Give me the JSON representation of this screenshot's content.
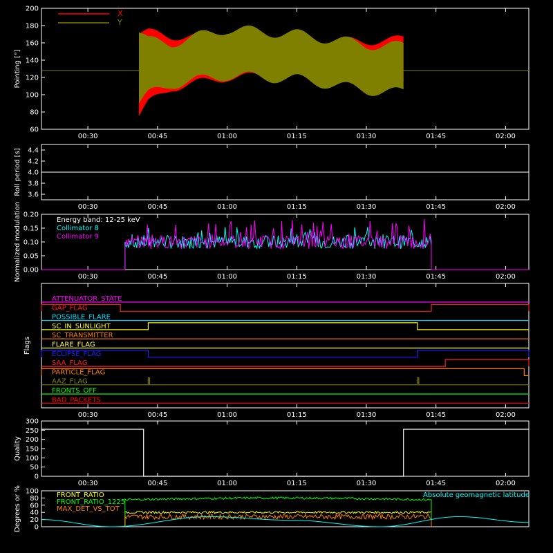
{
  "time_axis": {
    "range": [
      "00:20",
      "02:05"
    ],
    "ticks": [
      "00:30",
      "00:45",
      "01:00",
      "01:15",
      "01:30",
      "01:45",
      "02:00"
    ]
  },
  "chart_data": [
    {
      "id": "pointing",
      "type": "area",
      "ylabel": "Pointing [\"]",
      "ylim": [
        60,
        200
      ],
      "yticks": [
        "60",
        "80",
        "100",
        "120",
        "140",
        "160",
        "180",
        "200"
      ],
      "x_range": [
        "00:41",
        "01:38"
      ],
      "baseline": 128,
      "legend": [
        {
          "name": "X",
          "color": "#ff0000"
        },
        {
          "name": "Y",
          "color": "#808000"
        }
      ],
      "series": [
        {
          "name": "X",
          "color": "#ff0000",
          "envelope": {
            "x": [
              "00:41",
              "00:43",
              "00:48",
              "01:00",
              "01:15",
              "01:30",
              "01:38"
            ],
            "upper": [
              170,
              172,
              168,
              166,
              162,
              162,
              164
            ],
            "lower": [
              75,
              90,
              108,
              120,
              122,
              118,
              112
            ]
          }
        },
        {
          "name": "Y",
          "color": "#808000",
          "envelope": {
            "x": [
              "00:41",
              "00:43",
              "00:48",
              "01:00",
              "01:15",
              "01:30",
              "01:38"
            ],
            "upper": [
              172,
              162,
              160,
              176,
              170,
              158,
              156
            ],
            "lower": [
              90,
              100,
              112,
              122,
              118,
              105,
              102
            ]
          }
        }
      ]
    },
    {
      "id": "roll",
      "type": "line",
      "ylabel": "Roll period [s]",
      "ylim": [
        3.5,
        4.5
      ],
      "yticks": [
        "3.6",
        "3.8",
        "4.0",
        "4.2",
        "4.4"
      ],
      "series": [
        {
          "name": "",
          "color": "#ffffff",
          "x": [
            "00:20",
            "02:05"
          ],
          "y": [
            4.0,
            4.0
          ]
        }
      ]
    },
    {
      "id": "modulation",
      "type": "line",
      "ylabel": "Normalized modulation",
      "ylim": [
        0,
        0.2
      ],
      "yticks": [
        "0.00",
        "0.05",
        "0.10",
        "0.15",
        "0.20"
      ],
      "annotation": "Energy band: 12-25 keV",
      "active_range": [
        "00:38",
        "01:44"
      ],
      "series": [
        {
          "name": "Collimator 8",
          "color": "#00ffff",
          "mean": 0.1,
          "min": 0.075,
          "max": 0.155
        },
        {
          "name": "Collimator 9",
          "color": "#ff00ff",
          "mean": 0.1,
          "min": 0.07,
          "max": 0.185
        }
      ]
    },
    {
      "id": "flags",
      "type": "line",
      "ylabel": "Flags",
      "flags": [
        {
          "name": "ATTENUATOR_STATE",
          "color": "#ff00ff",
          "changes": []
        },
        {
          "name": "GAP_FLAG",
          "color": "#ff2020",
          "changes": [
            {
              "from": "00:20",
              "to": "00:37",
              "state": 1
            },
            {
              "from": "01:44",
              "to": "02:05",
              "state": 1
            }
          ]
        },
        {
          "name": "POSSIBLE_FLARE",
          "color": "#00e0ff",
          "changes": []
        },
        {
          "name": "SC_IN_SUNLIGHT",
          "color": "#ffff00",
          "changes": [
            {
              "from": "00:43",
              "to": "01:41",
              "state": 1
            }
          ]
        },
        {
          "name": "SC_TRANSMITTER",
          "color": "#ff8000",
          "changes": []
        },
        {
          "name": "FLARE_FLAG",
          "color": "#ffff60",
          "changes": []
        },
        {
          "name": "ECLIPSE_FLAG",
          "color": "#2020ff",
          "changes": [
            {
              "from": "00:20",
              "to": "00:43",
              "state": 1
            },
            {
              "from": "01:41",
              "to": "02:05",
              "state": 1
            }
          ]
        },
        {
          "name": "SAA_FLAG",
          "color": "#ff2020",
          "changes": [
            {
              "from": "01:47",
              "to": "02:05",
              "state": 1
            }
          ]
        },
        {
          "name": "PARTICLE_FLAG",
          "color": "#ff8000",
          "changes": [
            {
              "from": "00:20",
              "to": "02:04",
              "state": 1
            }
          ]
        },
        {
          "name": "AAZ_FLAG",
          "color": "#808000",
          "changes": [
            {
              "from": "00:43",
              "to": "00:43",
              "state": 1
            },
            {
              "from": "01:41",
              "to": "01:41",
              "state": 1
            }
          ]
        },
        {
          "name": "FRONTS_OFF",
          "color": "#00ff00",
          "changes": []
        },
        {
          "name": "BAD_PACKETS",
          "color": "#ff0000",
          "changes": []
        }
      ]
    },
    {
      "id": "quality",
      "type": "line",
      "ylabel": "Quality",
      "ylim": [
        0,
        300
      ],
      "yticks": [
        "0",
        "50",
        "100",
        "150",
        "200",
        "250",
        "300"
      ],
      "series": [
        {
          "name": "",
          "color": "#ffffff",
          "x": [
            "00:20",
            "00:42",
            "00:42",
            "01:38",
            "01:38",
            "02:05"
          ],
          "y": [
            255,
            255,
            0,
            0,
            255,
            255
          ]
        }
      ]
    },
    {
      "id": "ratios",
      "type": "line",
      "ylabel": "Degrees or %",
      "ylim": [
        0,
        100
      ],
      "yticks": [
        "0",
        "20",
        "40",
        "60",
        "80",
        "100"
      ],
      "active_range": [
        "00:38",
        "01:44"
      ],
      "series": [
        {
          "name": "FRONT_RATIO",
          "color": "#ffff00",
          "mean": 40
        },
        {
          "name": "FRONT_RATIO_1225",
          "color": "#00ff00",
          "mean": 75
        },
        {
          "name": "MAX_DET_VS_TOT",
          "color": "#ff8000",
          "mean": 28
        },
        {
          "name": "Absolute geomagnetic latitude",
          "color": "#00ffff",
          "x": [
            "00:20",
            "00:35",
            "00:56",
            "01:14",
            "01:33",
            "01:50",
            "02:05"
          ],
          "y": [
            20,
            0,
            28,
            18,
            0,
            28,
            12
          ]
        }
      ]
    }
  ]
}
